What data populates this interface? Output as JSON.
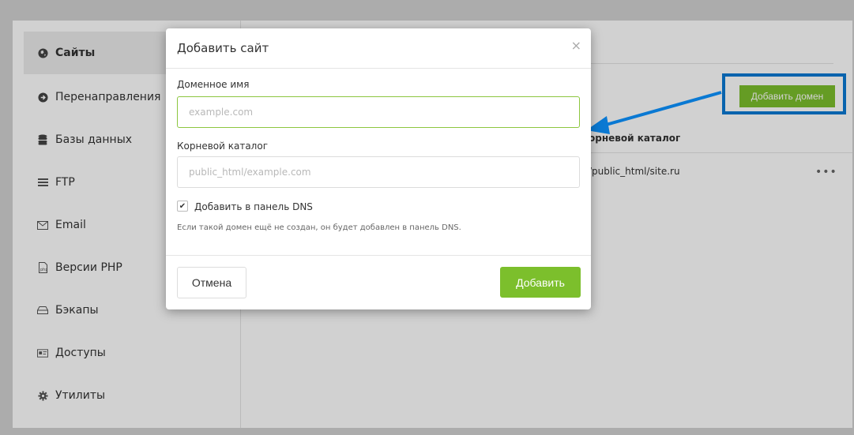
{
  "sidebar": {
    "items": [
      {
        "label": "Сайты",
        "icon": "globe-icon",
        "active": true
      },
      {
        "label": "Перенаправления",
        "icon": "arrow-right-circle-icon"
      },
      {
        "label": "Базы данных",
        "icon": "database-icon"
      },
      {
        "label": "FTP",
        "icon": "ftp-list-icon"
      },
      {
        "label": "Email",
        "icon": "envelope-icon"
      },
      {
        "label": "Версии PHP",
        "icon": "php-file-icon"
      },
      {
        "label": "Бэкапы",
        "icon": "backup-drive-icon"
      },
      {
        "label": "Доступы",
        "icon": "id-card-icon"
      },
      {
        "label": "Утилиты",
        "icon": "gear-icon"
      }
    ]
  },
  "main": {
    "add_domain_label": "Добавить домен",
    "column_header": "орневой каталог",
    "row_root": "/public_html/site.ru",
    "row_menu": "•••"
  },
  "modal": {
    "title": "Добавить сайт",
    "close": "×",
    "domain_label": "Доменное имя",
    "domain_placeholder": "example.com",
    "root_label": "Корневой каталог",
    "root_placeholder": "public_html/example.com",
    "checkbox_label": "Добавить в панель DNS",
    "checkbox_checked": true,
    "hint": "Если такой домен ещё не создан, он будет добавлен в панель DNS.",
    "cancel_label": "Отмена",
    "submit_label": "Добавить"
  },
  "colors": {
    "accent_green": "#7cbf2c",
    "highlight_blue": "#0a79d3"
  }
}
